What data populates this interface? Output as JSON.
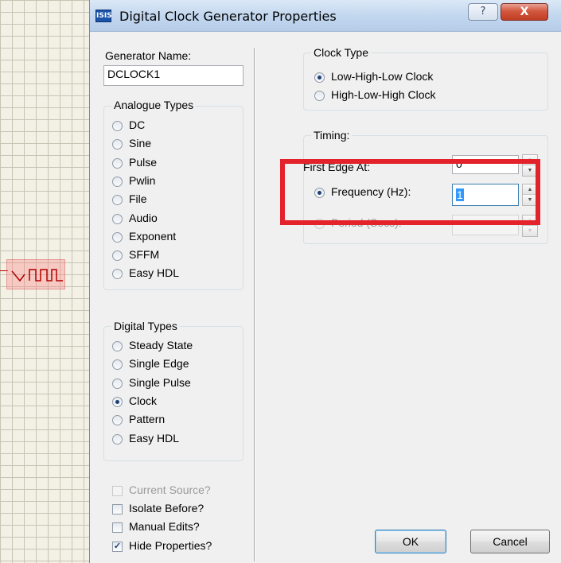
{
  "window": {
    "title": "Digital Clock Generator Properties",
    "help_symbol": "?",
    "close_symbol": "X",
    "app_icon_text": "ISIS"
  },
  "left": {
    "generator_name_label": "Generator Name:",
    "generator_name_value": "DCLOCK1",
    "analogue_group_title": "Analogue Types",
    "analogue_types": [
      "DC",
      "Sine",
      "Pulse",
      "Pwlin",
      "File",
      "Audio",
      "Exponent",
      "SFFM",
      "Easy HDL"
    ],
    "digital_group_title": "Digital Types",
    "digital_types": [
      "Steady State",
      "Single Edge",
      "Single Pulse",
      "Clock",
      "Pattern",
      "Easy HDL"
    ],
    "digital_selected": "Clock",
    "options": {
      "current_source": "Current Source?",
      "isolate_before": "Isolate Before?",
      "manual_edits": "Manual Edits?",
      "hide_properties": "Hide Properties?"
    }
  },
  "right": {
    "clock_type_title": "Clock Type",
    "clock_types": [
      "Low-High-Low Clock",
      "High-Low-High Clock"
    ],
    "clock_type_selected": "Low-High-Low Clock",
    "timing_title": "Timing:",
    "first_edge_label": "First Edge At:",
    "first_edge_value": "0",
    "frequency_label": "Frequency (Hz):",
    "frequency_value": "1",
    "period_label": "Period (Secs):",
    "period_value": ""
  },
  "buttons": {
    "ok": "OK",
    "cancel": "Cancel"
  },
  "annotation": {
    "highlight_color": "#e3222c"
  }
}
